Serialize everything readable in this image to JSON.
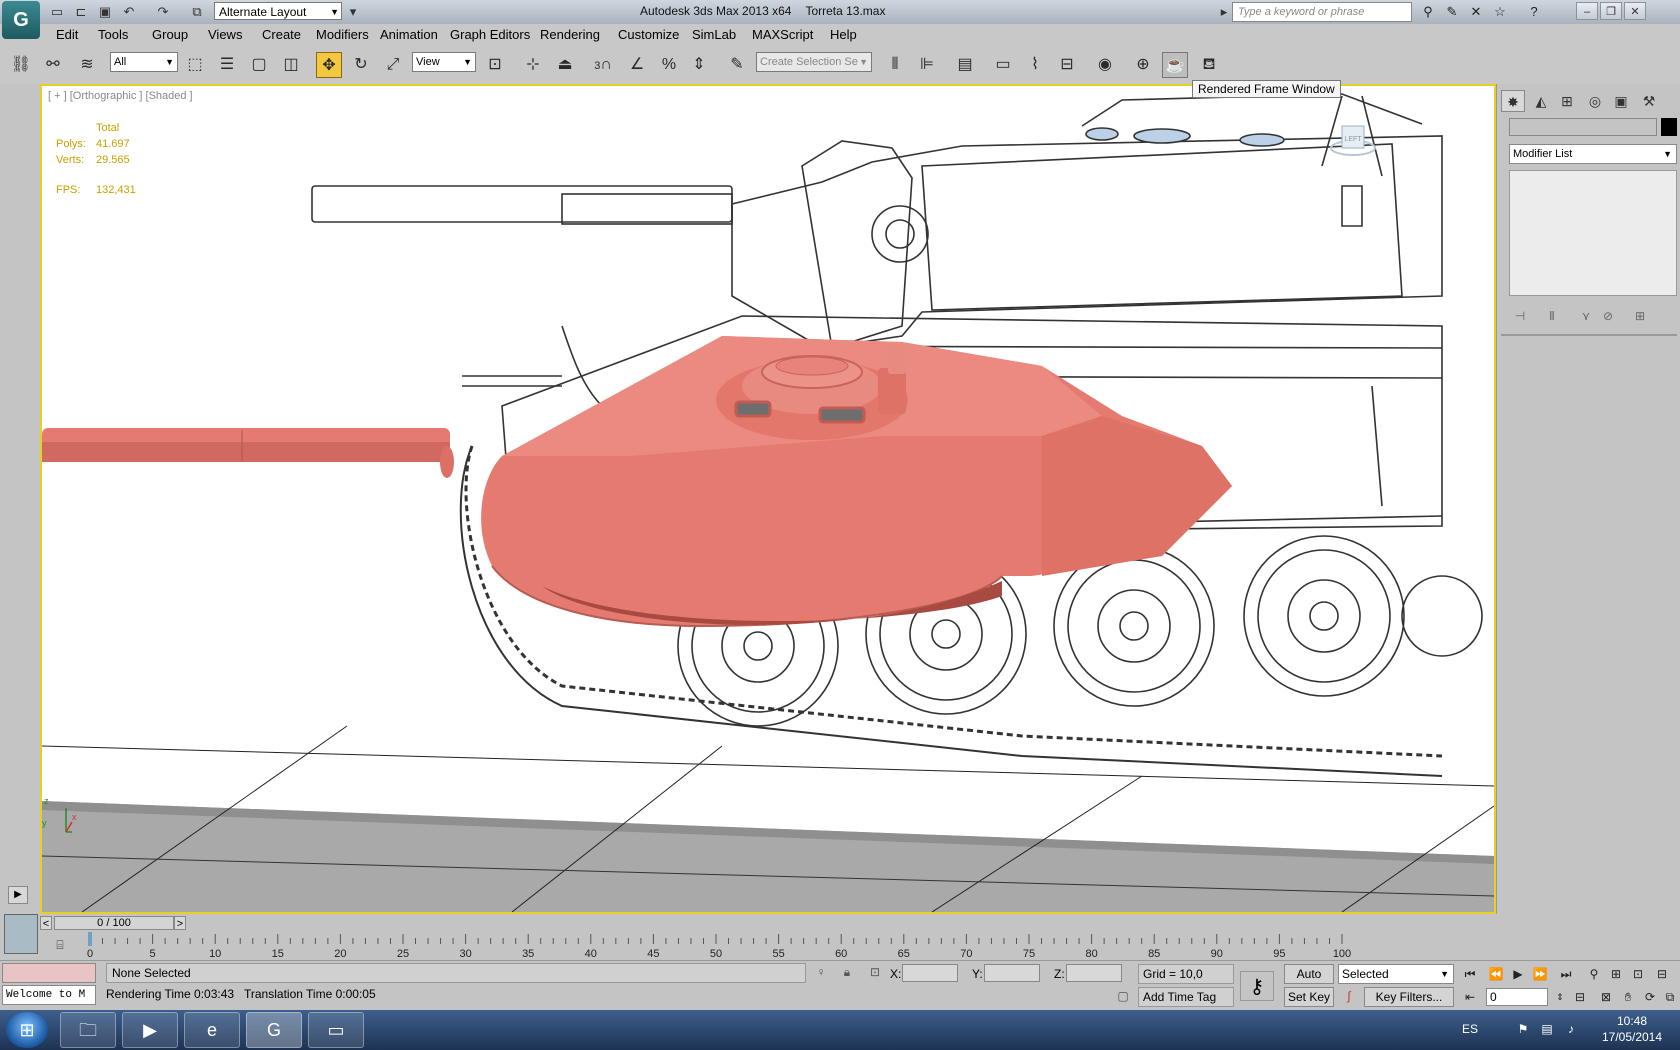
{
  "titlebar": {
    "workspace": "Alternate Layout",
    "app_name": "Autodesk 3ds Max  2013 x64",
    "file_name": "Torreta 13.max",
    "search_placeholder": "Type a keyword or phrase"
  },
  "menu": [
    "Edit",
    "Tools",
    "Group",
    "Views",
    "Create",
    "Modifiers",
    "Animation",
    "Graph Editors",
    "Rendering",
    "Customize",
    "SimLab",
    "MAXScript",
    "Help"
  ],
  "toolbar": {
    "selection_filter": "All",
    "ref_coord": "View",
    "snap_value": "3",
    "selection_set_placeholder": "Create Selection Se",
    "tooltip": "Rendered Frame Window"
  },
  "viewport": {
    "label": "[ + ] [Orthographic ] [Shaded ]",
    "stats_header": "Total",
    "stats": [
      {
        "key": "Polys:",
        "value": "41.697"
      },
      {
        "key": "Verts:",
        "value": "29.565"
      },
      {
        "key": "FPS:",
        "value": "132,431"
      }
    ],
    "viewcube_label": "LEFT",
    "axis_labels": {
      "x": "x",
      "y": "y",
      "z": "z"
    }
  },
  "command_panel": {
    "modifier_list": "Modifier List"
  },
  "timeline": {
    "slider_value": "0 / 100",
    "prev": "<",
    "next": ">",
    "ticks": [
      "0",
      "5",
      "10",
      "15",
      "20",
      "25",
      "30",
      "35",
      "40",
      "45",
      "50",
      "55",
      "60",
      "65",
      "70",
      "75",
      "80",
      "85",
      "90",
      "95",
      "100"
    ]
  },
  "status": {
    "welcome": "Welcome to M",
    "selection": "None Selected",
    "rendering_time": "Rendering Time  0:03:43",
    "translation_time": "Translation Time  0:00:05",
    "x_label": "X:",
    "y_label": "Y:",
    "z_label": "Z:",
    "grid": "Grid = 10,0",
    "add_time_tag": "Add Time Tag",
    "auto_key": "Auto Key",
    "set_key": "Set Key",
    "key_mode": "Selected",
    "key_filters": "Key Filters...",
    "frame": "0"
  },
  "taskbar": {
    "language": "ES",
    "time": "10:48",
    "date": "17/05/2014"
  },
  "colors": {
    "turret": "#e57b70",
    "viewport_border": "#e8d020",
    "active_tool": "#f3c840",
    "stats_text": "#c8a000"
  }
}
